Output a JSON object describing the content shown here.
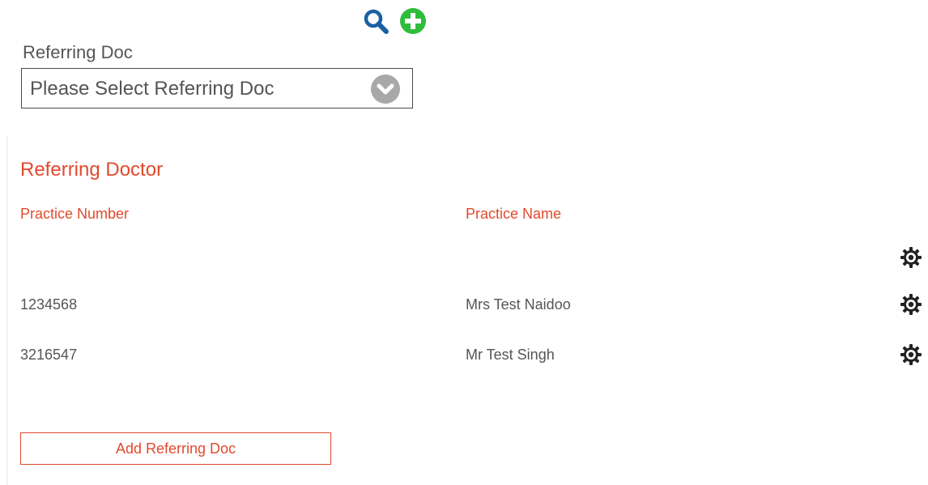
{
  "toolbar": {
    "search_icon": "search-icon",
    "add_icon": "add-circle-icon",
    "search_color": "#1a5fa3",
    "add_color": "#2ebd3b"
  },
  "selector": {
    "label": "Referring Doc",
    "placeholder": "Please Select Referring Doc",
    "chevron_icon": "chevron-down-circle-icon"
  },
  "referring_doctor": {
    "title": "Referring Doctor",
    "columns": {
      "practice_number": "Practice Number",
      "practice_name": "Practice Name"
    },
    "rows": [
      {
        "practice_number": "",
        "practice_name": "",
        "action_icon": "gear-icon"
      },
      {
        "practice_number": "1234568",
        "practice_name": "Mrs Test Naidoo",
        "action_icon": "gear-icon"
      },
      {
        "practice_number": "3216547",
        "practice_name": "Mr Test Singh",
        "action_icon": "gear-icon"
      }
    ],
    "add_button_label": "Add Referring Doc"
  },
  "colors": {
    "accent": "#e2492d",
    "text": "#555555",
    "border": "#4a4a4a"
  }
}
